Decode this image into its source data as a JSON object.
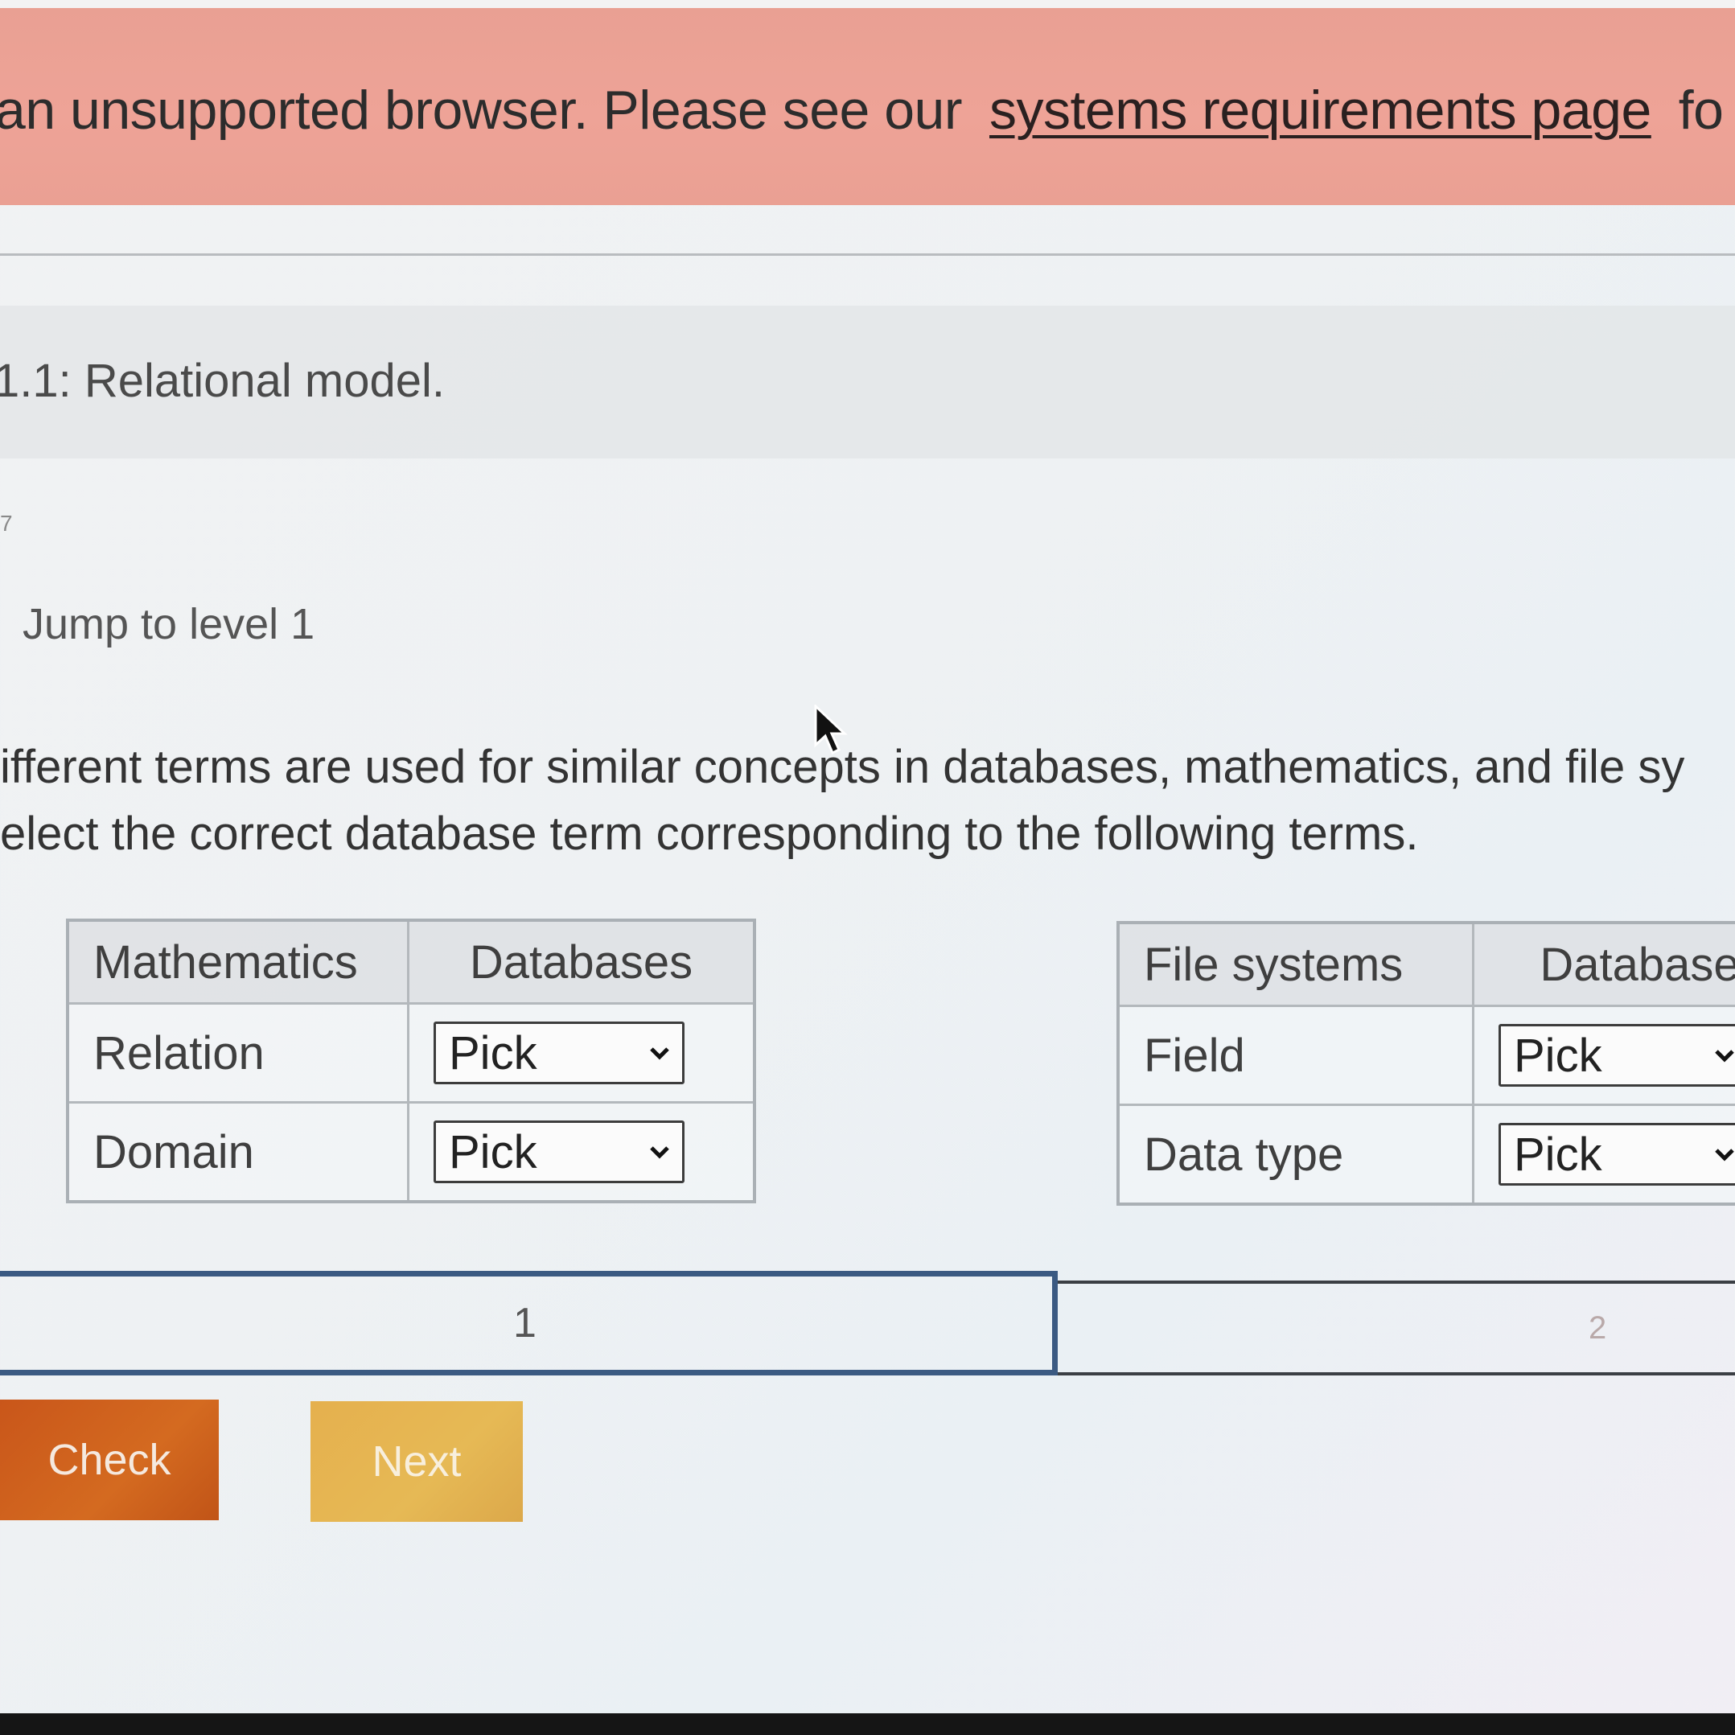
{
  "banner": {
    "text": "an unsupported browser. Please see our",
    "link": "systems requirements page",
    "tail": "fo"
  },
  "section": {
    "title": "1.1: Relational model.",
    "small_mark": "7",
    "jump_level": "Jump to level 1"
  },
  "instructions": {
    "line1": "ifferent terms are used for similar concepts in databases, mathematics, and file sy",
    "line2": "elect the correct database term corresponding to the following terms."
  },
  "table_math": {
    "headers": [
      "Mathematics",
      "Databases"
    ],
    "rows": [
      {
        "term": "Relation",
        "select": "Pick"
      },
      {
        "term": "Domain",
        "select": "Pick"
      }
    ]
  },
  "table_files": {
    "headers": [
      "File systems",
      "Database"
    ],
    "rows": [
      {
        "term": "Field",
        "select": "Pick"
      },
      {
        "term": "Data type",
        "select": "Pick"
      }
    ]
  },
  "levels": [
    "1",
    "2"
  ],
  "buttons": {
    "check": "Check",
    "next": "Next"
  },
  "colors": {
    "banner": "#eea397",
    "level_active_border": "#3b5a82",
    "check_button": "#d46a20",
    "next_button": "#e6b955"
  }
}
